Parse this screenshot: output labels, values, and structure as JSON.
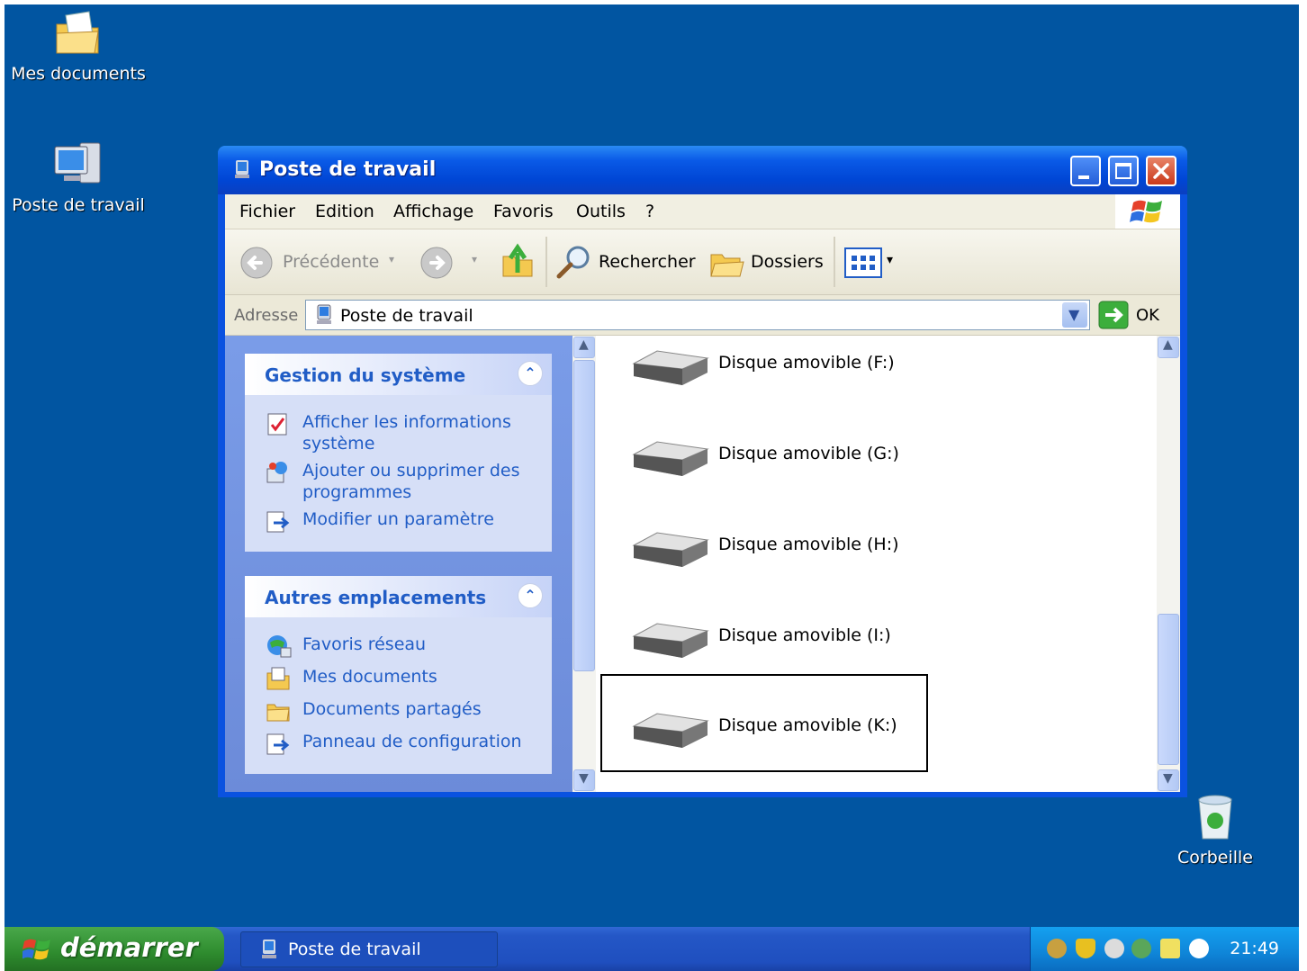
{
  "desktop": {
    "icons": [
      {
        "label": "Mes documents",
        "icon": "my-documents-icon"
      },
      {
        "label": "Poste de travail",
        "icon": "my-computer-icon"
      },
      {
        "label": "Corbeille",
        "icon": "recycle-bin-icon"
      }
    ],
    "background_color": "#0155a1"
  },
  "window": {
    "title": "Poste de travail",
    "menu": [
      "Fichier",
      "Edition",
      "Affichage",
      "Favoris",
      "Outils",
      "?"
    ],
    "toolbar": {
      "back_label": "Précédente",
      "search_label": "Rechercher",
      "folders_label": "Dossiers"
    },
    "address": {
      "label": "Adresse",
      "value": "Poste de travail",
      "go_label": "OK"
    },
    "panels": [
      {
        "title": "Gestion du système",
        "links": [
          {
            "line1": "Afficher les informations",
            "line2": "système",
            "icon": "system-info-icon"
          },
          {
            "line1": "Ajouter ou supprimer des",
            "line2": "programmes",
            "icon": "add-remove-programs-icon"
          },
          {
            "line1": "Modifier un paramètre",
            "line2": "",
            "icon": "control-panel-icon"
          }
        ]
      },
      {
        "title": "Autres emplacements",
        "links": [
          {
            "line1": "Favoris réseau",
            "icon": "network-places-icon"
          },
          {
            "line1": "Mes documents",
            "icon": "my-documents-icon"
          },
          {
            "line1": "Documents partagés",
            "icon": "shared-folder-icon"
          },
          {
            "line1": "Panneau de configuration",
            "icon": "control-panel-icon"
          }
        ]
      }
    ],
    "drives": [
      "Disque amovible (F:)",
      "Disque amovible (G:)",
      "Disque amovible (H:)",
      "Disque amovible (I:)",
      "Disque amovible (K:)"
    ],
    "selected_drive": "Disque amovible (K:)"
  },
  "taskbar": {
    "start_label": "démarrer",
    "task_label": "Poste de travail",
    "clock": "21:49"
  }
}
